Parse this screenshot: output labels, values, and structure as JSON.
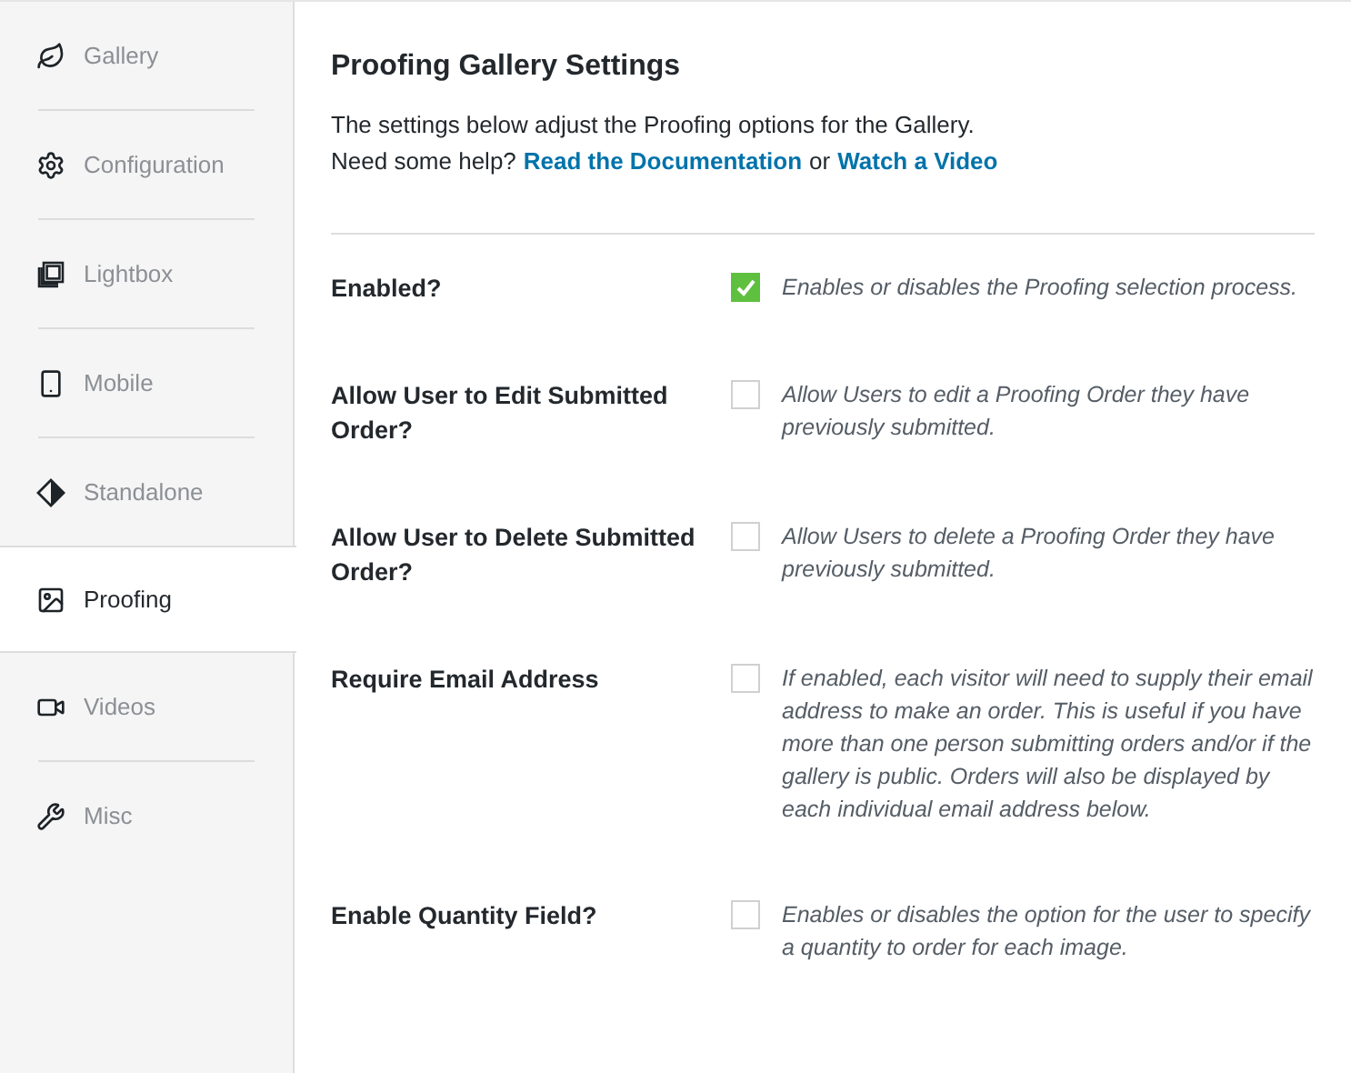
{
  "sidebar": {
    "items": [
      {
        "label": "Gallery",
        "selected": false
      },
      {
        "label": "Configuration",
        "selected": false
      },
      {
        "label": "Lightbox",
        "selected": false
      },
      {
        "label": "Mobile",
        "selected": false
      },
      {
        "label": "Standalone",
        "selected": false
      },
      {
        "label": "Proofing",
        "selected": true
      },
      {
        "label": "Videos",
        "selected": false
      },
      {
        "label": "Misc",
        "selected": false
      }
    ]
  },
  "header": {
    "title": "Proofing Gallery Settings",
    "intro": "The settings below adjust the Proofing options for the Gallery.",
    "help_prefix": "Need some help?",
    "doc_link": "Read the Documentation",
    "or": "or",
    "video_link": "Watch a Video"
  },
  "settings": [
    {
      "label": "Enabled?",
      "checked": true,
      "description": "Enables or disables the Proofing selection process."
    },
    {
      "label": "Allow User to Edit Submitted Order?",
      "checked": false,
      "description": "Allow Users to edit a Proofing Order they have previously submitted."
    },
    {
      "label": "Allow User to Delete Submitted Order?",
      "checked": false,
      "description": "Allow Users to delete a Proofing Order they have previously submitted."
    },
    {
      "label": "Require Email Address",
      "checked": false,
      "description": "If enabled, each visitor will need to supply their email address to make an order. This is useful if you have more than one person submitting orders and/or if the gallery is public. Orders will also be displayed by each individual email address below."
    },
    {
      "label": "Enable Quantity Field?",
      "checked": false,
      "description": "Enables or disables the option for the user to specify a quantity to order for each image."
    }
  ]
}
